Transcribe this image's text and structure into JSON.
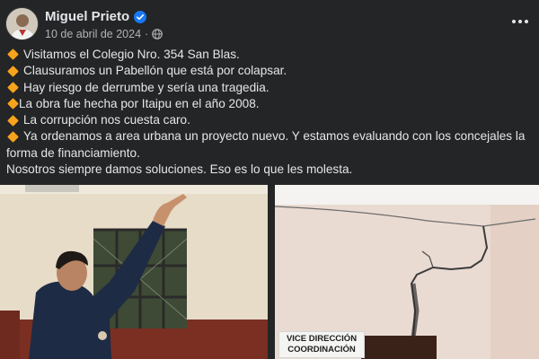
{
  "post": {
    "author": "Miguel Prieto",
    "date": "10 de abril de 2024",
    "separator": "·",
    "avatar_icon": "profile-photo",
    "verified_icon": "verified-badge-icon",
    "privacy_icon": "globe-icon",
    "more_icon": "more-options-icon",
    "bullet_icon": "orange-diamond-icon",
    "colors": {
      "background": "#242526",
      "text": "#e4e6eb",
      "secondary": "#b0b3b8",
      "verified": "#1877f2",
      "bullet": "#f7a31c"
    },
    "lines": [
      {
        "bullet": true,
        "text": "Visitamos el Colegio Nro. 354 San Blas."
      },
      {
        "bullet": true,
        "text": "Clausuramos un Pabellón que está por colapsar."
      },
      {
        "bullet": true,
        "text": "Hay riesgo de derrumbe y sería una tragedia."
      },
      {
        "bullet": true,
        "text": "La obra fue hecha por Itaipu en el año 2008."
      },
      {
        "bullet": true,
        "text": "La corrupción nos cuesta caro."
      },
      {
        "bullet": true,
        "text": "Ya ordenamos a area urbana un proyecto nuevo. Y estamos evaluando con los concejales la forma de financiamiento."
      },
      {
        "bullet": false,
        "text": "Nosotros siempre damos soluciones. Eso es lo que les molesta."
      }
    ]
  },
  "photos": {
    "left": {
      "content": "man-pointing-at-ceiling-photo"
    },
    "right": {
      "content": "cracked-wall-photo",
      "sign_line1": "VICE DIRECCIÓN",
      "sign_line2": "COORDINACIÓN"
    }
  }
}
